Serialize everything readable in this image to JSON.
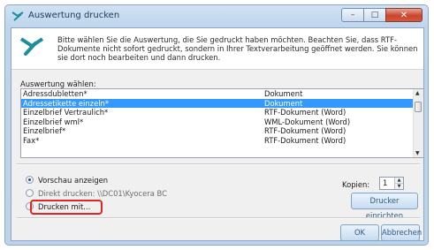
{
  "window": {
    "title": "Auswertung drucken",
    "minimize_glyph": "–",
    "maximize_glyph": "□",
    "close_glyph": "✕"
  },
  "banner": {
    "icon": "arrow-x-logo-icon",
    "text": "Bitte wählen Sie die Auswertung, die Sie gedruckt haben möchten. Beachten Sie, dass RTF-Dokumente nicht sofort gedruckt, sondern in Ihrer Textverarbeitung geöffnet werden. Sie können sie dort noch bearbeiten und dann drucken."
  },
  "list": {
    "label": "Auswertung wählen:",
    "items": [
      {
        "name": "Adressdubletten*",
        "type": "Dokument"
      },
      {
        "name": "Adressetikette einzeln*",
        "type": "Dokument"
      },
      {
        "name": "Einzelbrief Vertraulich*",
        "type": "RTF-Dokument (Word)"
      },
      {
        "name": "Einzelbrief wml*",
        "type": "WML-Dokument (Word)"
      },
      {
        "name": "Einzelbrief*",
        "type": "RTF-Dokument (Word)"
      },
      {
        "name": "Fax*",
        "type": "RTF-Dokument (Word)"
      }
    ],
    "selected_index": 1,
    "scroll_up_glyph": "▲",
    "scroll_down_glyph": "▼"
  },
  "options": {
    "preview": "Vorschau anzeigen",
    "direct_print": "Direkt drucken: \\\\DC01\\Kyocera BC",
    "print_with": "Drucken mit...",
    "selected": "preview"
  },
  "copies": {
    "label": "Kopien:",
    "value": "1",
    "up_glyph": "▲",
    "down_glyph": "▼"
  },
  "buttons": {
    "printer_setup": "Drucker einrichten",
    "ok": "OK",
    "cancel": "Abbrechen"
  },
  "colors": {
    "selection": "#3399ff",
    "highlight_border": "#e32424",
    "window_frame": "#bfd5ec"
  }
}
